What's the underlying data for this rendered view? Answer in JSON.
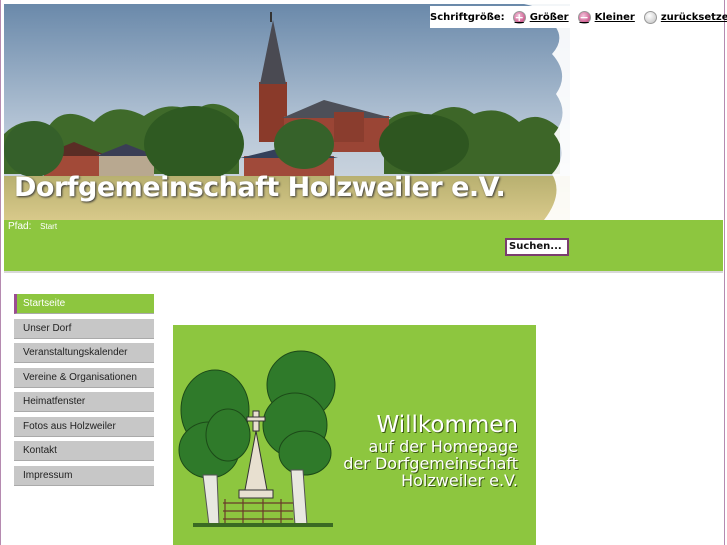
{
  "header": {
    "site_title": "Dorfgemeinschaft Holzweiler e.V."
  },
  "font_controls": {
    "label": "Schriftgröße:",
    "bigger": "Größer",
    "smaller": "Kleiner",
    "reset": "zurücksetzen"
  },
  "breadcrumb": {
    "label": "Pfad:",
    "current": "Start"
  },
  "search": {
    "button_label": "Suchen..."
  },
  "sidebar": {
    "items": [
      {
        "label": "Startseite"
      },
      {
        "label": "Unser Dorf"
      },
      {
        "label": "Veranstaltungskalender"
      },
      {
        "label": "Vereine & Organisationen"
      },
      {
        "label": "Heimatfenster"
      },
      {
        "label": "Fotos aus Holzweiler"
      },
      {
        "label": "Kontakt"
      },
      {
        "label": "Impressum"
      }
    ]
  },
  "welcome": {
    "line1": "Willkommen",
    "line2": "auf der Homepage",
    "line3": "der Dorfgemeinschaft",
    "line4": "Holzweiler e.V."
  },
  "colors": {
    "accent_green": "#8dc63f",
    "accent_purple": "#9b4d92",
    "nav_gray": "#c7c7c7"
  }
}
